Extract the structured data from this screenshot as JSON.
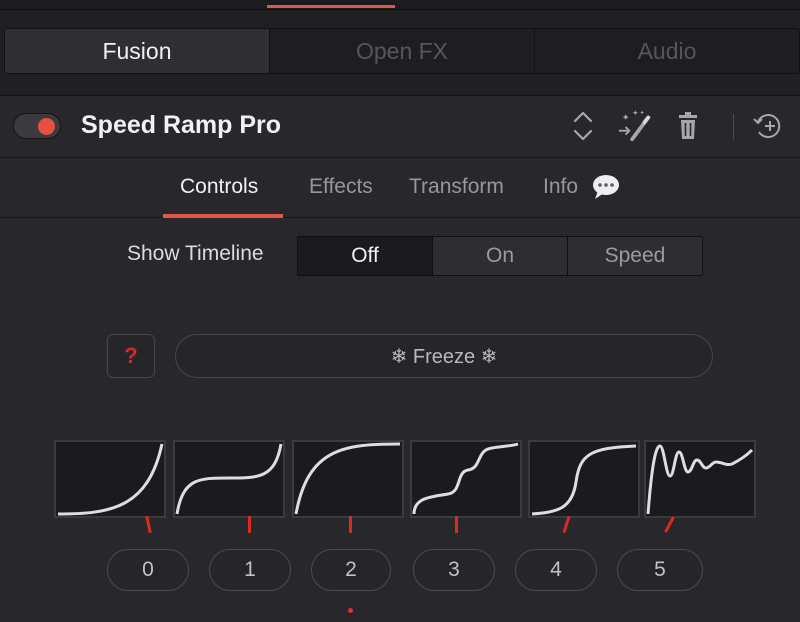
{
  "categories": [
    "Fusion",
    "Open FX",
    "Audio"
  ],
  "effect": {
    "title": "Speed Ramp Pro",
    "enabled": true,
    "icons": [
      "updown-chevron-icon",
      "magic-wand-icon",
      "trash-icon",
      "reset-icon"
    ]
  },
  "tabs": [
    "Controls",
    "Effects",
    "Transform",
    "Info"
  ],
  "info_icon": "speech-bubble-icon",
  "show_timeline": {
    "label": "Show Timeline",
    "options": [
      "Off",
      "On",
      "Speed"
    ],
    "selected": "Off"
  },
  "help_button": {
    "glyph": "?"
  },
  "freeze_button": {
    "label": "❄ Freeze ❄"
  },
  "presets": {
    "curve_icons": [
      "ease-in-curve-icon",
      "s-curve-icon",
      "ease-out-curve-icon",
      "double-step-curve-icon",
      "step-curve-icon",
      "bounce-curve-icon"
    ],
    "numbers": [
      "0",
      "1",
      "2",
      "3",
      "4",
      "5"
    ],
    "selected": "2"
  },
  "colors": {
    "accent": "#e2574c",
    "background": "#28282c",
    "help_glyph": "#d52a25"
  }
}
